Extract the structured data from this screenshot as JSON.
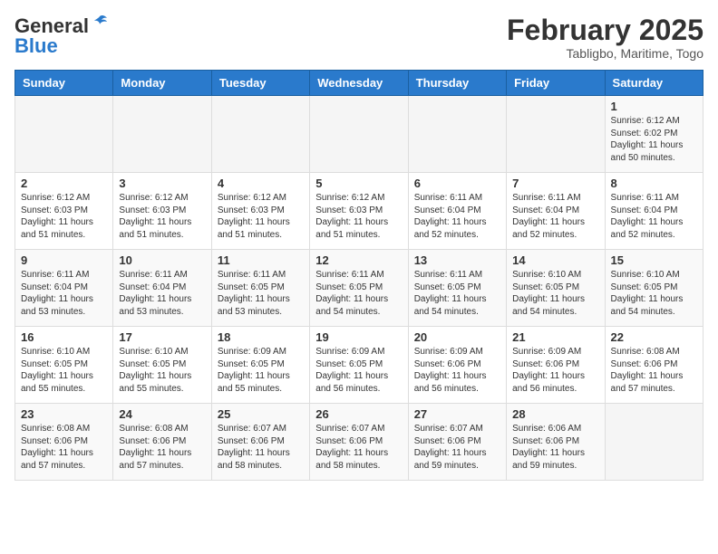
{
  "header": {
    "logo_general": "General",
    "logo_blue": "Blue",
    "main_title": "February 2025",
    "subtitle": "Tabligbo, Maritime, Togo"
  },
  "weekdays": [
    "Sunday",
    "Monday",
    "Tuesday",
    "Wednesday",
    "Thursday",
    "Friday",
    "Saturday"
  ],
  "weeks": [
    [
      {
        "day": "",
        "info": ""
      },
      {
        "day": "",
        "info": ""
      },
      {
        "day": "",
        "info": ""
      },
      {
        "day": "",
        "info": ""
      },
      {
        "day": "",
        "info": ""
      },
      {
        "day": "",
        "info": ""
      },
      {
        "day": "1",
        "info": "Sunrise: 6:12 AM\nSunset: 6:02 PM\nDaylight: 11 hours\nand 50 minutes."
      }
    ],
    [
      {
        "day": "2",
        "info": "Sunrise: 6:12 AM\nSunset: 6:03 PM\nDaylight: 11 hours\nand 51 minutes."
      },
      {
        "day": "3",
        "info": "Sunrise: 6:12 AM\nSunset: 6:03 PM\nDaylight: 11 hours\nand 51 minutes."
      },
      {
        "day": "4",
        "info": "Sunrise: 6:12 AM\nSunset: 6:03 PM\nDaylight: 11 hours\nand 51 minutes."
      },
      {
        "day": "5",
        "info": "Sunrise: 6:12 AM\nSunset: 6:03 PM\nDaylight: 11 hours\nand 51 minutes."
      },
      {
        "day": "6",
        "info": "Sunrise: 6:11 AM\nSunset: 6:04 PM\nDaylight: 11 hours\nand 52 minutes."
      },
      {
        "day": "7",
        "info": "Sunrise: 6:11 AM\nSunset: 6:04 PM\nDaylight: 11 hours\nand 52 minutes."
      },
      {
        "day": "8",
        "info": "Sunrise: 6:11 AM\nSunset: 6:04 PM\nDaylight: 11 hours\nand 52 minutes."
      }
    ],
    [
      {
        "day": "9",
        "info": "Sunrise: 6:11 AM\nSunset: 6:04 PM\nDaylight: 11 hours\nand 53 minutes."
      },
      {
        "day": "10",
        "info": "Sunrise: 6:11 AM\nSunset: 6:04 PM\nDaylight: 11 hours\nand 53 minutes."
      },
      {
        "day": "11",
        "info": "Sunrise: 6:11 AM\nSunset: 6:05 PM\nDaylight: 11 hours\nand 53 minutes."
      },
      {
        "day": "12",
        "info": "Sunrise: 6:11 AM\nSunset: 6:05 PM\nDaylight: 11 hours\nand 54 minutes."
      },
      {
        "day": "13",
        "info": "Sunrise: 6:11 AM\nSunset: 6:05 PM\nDaylight: 11 hours\nand 54 minutes."
      },
      {
        "day": "14",
        "info": "Sunrise: 6:10 AM\nSunset: 6:05 PM\nDaylight: 11 hours\nand 54 minutes."
      },
      {
        "day": "15",
        "info": "Sunrise: 6:10 AM\nSunset: 6:05 PM\nDaylight: 11 hours\nand 54 minutes."
      }
    ],
    [
      {
        "day": "16",
        "info": "Sunrise: 6:10 AM\nSunset: 6:05 PM\nDaylight: 11 hours\nand 55 minutes."
      },
      {
        "day": "17",
        "info": "Sunrise: 6:10 AM\nSunset: 6:05 PM\nDaylight: 11 hours\nand 55 minutes."
      },
      {
        "day": "18",
        "info": "Sunrise: 6:09 AM\nSunset: 6:05 PM\nDaylight: 11 hours\nand 55 minutes."
      },
      {
        "day": "19",
        "info": "Sunrise: 6:09 AM\nSunset: 6:05 PM\nDaylight: 11 hours\nand 56 minutes."
      },
      {
        "day": "20",
        "info": "Sunrise: 6:09 AM\nSunset: 6:06 PM\nDaylight: 11 hours\nand 56 minutes."
      },
      {
        "day": "21",
        "info": "Sunrise: 6:09 AM\nSunset: 6:06 PM\nDaylight: 11 hours\nand 56 minutes."
      },
      {
        "day": "22",
        "info": "Sunrise: 6:08 AM\nSunset: 6:06 PM\nDaylight: 11 hours\nand 57 minutes."
      }
    ],
    [
      {
        "day": "23",
        "info": "Sunrise: 6:08 AM\nSunset: 6:06 PM\nDaylight: 11 hours\nand 57 minutes."
      },
      {
        "day": "24",
        "info": "Sunrise: 6:08 AM\nSunset: 6:06 PM\nDaylight: 11 hours\nand 57 minutes."
      },
      {
        "day": "25",
        "info": "Sunrise: 6:07 AM\nSunset: 6:06 PM\nDaylight: 11 hours\nand 58 minutes."
      },
      {
        "day": "26",
        "info": "Sunrise: 6:07 AM\nSunset: 6:06 PM\nDaylight: 11 hours\nand 58 minutes."
      },
      {
        "day": "27",
        "info": "Sunrise: 6:07 AM\nSunset: 6:06 PM\nDaylight: 11 hours\nand 59 minutes."
      },
      {
        "day": "28",
        "info": "Sunrise: 6:06 AM\nSunset: 6:06 PM\nDaylight: 11 hours\nand 59 minutes."
      },
      {
        "day": "",
        "info": ""
      }
    ]
  ]
}
